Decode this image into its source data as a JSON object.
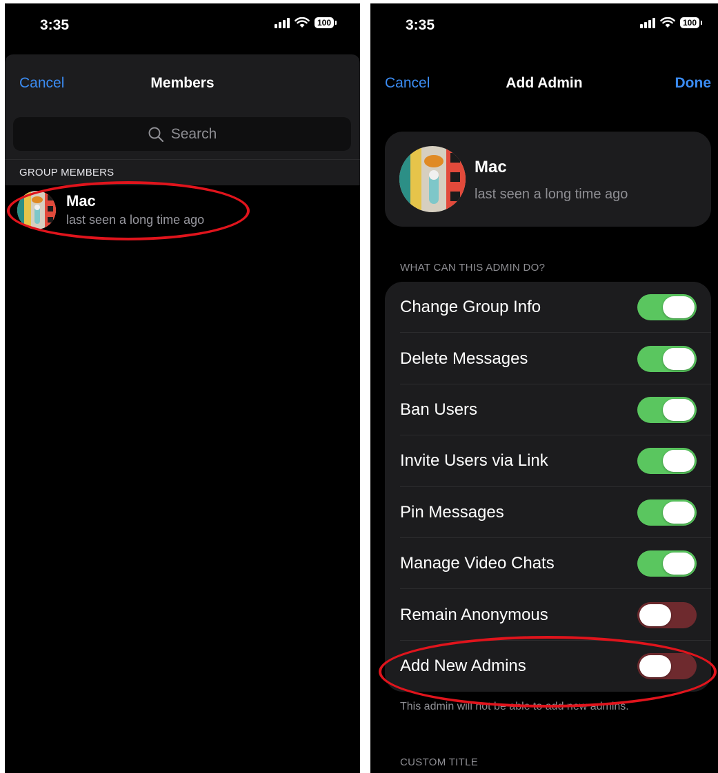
{
  "left_screen": {
    "status_bar": {
      "time": "3:35",
      "battery": "100"
    },
    "nav": {
      "cancel_label": "Cancel",
      "title": "Members"
    },
    "search": {
      "placeholder": "Search"
    },
    "section_header": "GROUP MEMBERS",
    "members": [
      {
        "name": "Mac",
        "status": "last seen a long time ago"
      }
    ]
  },
  "right_screen": {
    "status_bar": {
      "time": "3:35",
      "battery": "100"
    },
    "nav": {
      "cancel_label": "Cancel",
      "title": "Add Admin",
      "done_label": "Done"
    },
    "profile": {
      "name": "Mac",
      "status": "last seen a long time ago"
    },
    "permissions_header": "WHAT CAN THIS ADMIN DO?",
    "permissions": [
      {
        "label": "Change Group Info",
        "enabled": true
      },
      {
        "label": "Delete Messages",
        "enabled": true
      },
      {
        "label": "Ban Users",
        "enabled": true
      },
      {
        "label": "Invite Users via Link",
        "enabled": true
      },
      {
        "label": "Pin Messages",
        "enabled": true
      },
      {
        "label": "Manage Video Chats",
        "enabled": true
      },
      {
        "label": "Remain Anonymous",
        "enabled": false
      },
      {
        "label": "Add New Admins",
        "enabled": false
      }
    ],
    "permissions_footer": "This admin will not be able to add new admins.",
    "custom_title_header": "CUSTOM TITLE"
  },
  "colors": {
    "accent_blue": "#3b8cf3",
    "toggle_on": "#5ac65f",
    "toggle_off": "#6e2a2e",
    "highlight_red": "#e0141c"
  },
  "icons": [
    "signal-icon",
    "wifi-icon",
    "battery-icon",
    "search-icon",
    "avatar-image"
  ]
}
